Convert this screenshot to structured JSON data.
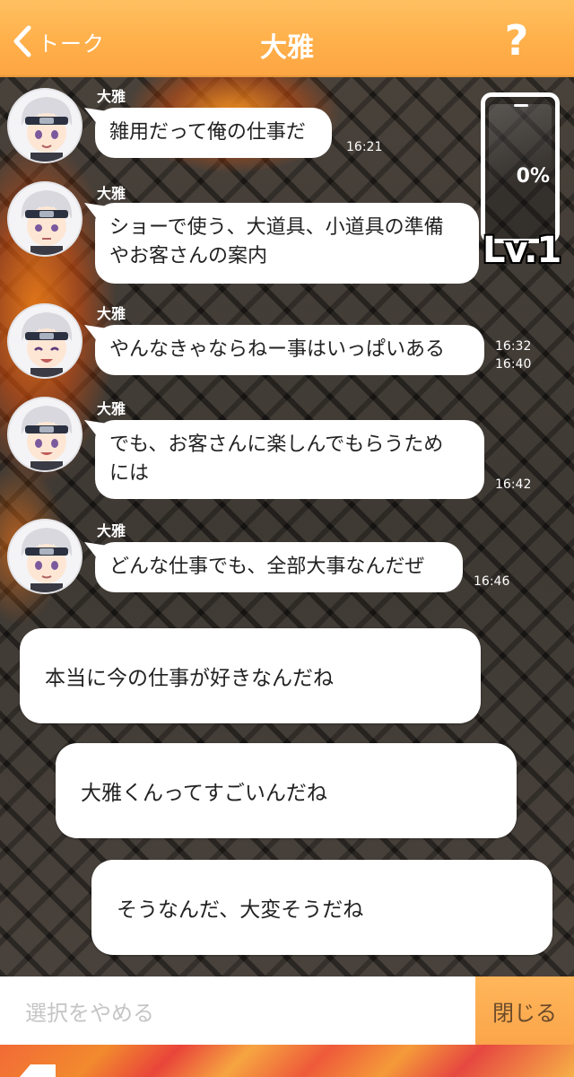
{
  "header": {
    "back_label": "トーク",
    "title": "大雅",
    "help_label": "?"
  },
  "meter": {
    "percent": "0%",
    "level": "Lv.1"
  },
  "messages": [
    {
      "sender": "大雅",
      "lines": [
        "雑用だって俺の仕事だ"
      ],
      "time": "16:21"
    },
    {
      "sender": "大雅",
      "lines": [
        "ショーで使う、大道具、小道具の準備",
        "やお客さんの案内"
      ],
      "time": "16:32"
    },
    {
      "sender": "大雅",
      "lines": [
        "やんなきゃならねー事はいっぱいある"
      ],
      "time": "16:40"
    },
    {
      "sender": "大雅",
      "lines": [
        "でも、お客さんに楽しんでもらうため",
        "には"
      ],
      "time": "16:42"
    },
    {
      "sender": "大雅",
      "lines": [
        "どんな仕事でも、全部大事なんだぜ"
      ],
      "time": "16:46"
    }
  ],
  "choices": [
    "本当に今の仕事が好きなんだね",
    "大雅くんってすごいんだね",
    "そうなんだ、大変そうだね"
  ],
  "bottom_bar": {
    "cancel_label": "選択をやめる",
    "close_label": "閉じる"
  },
  "colors": {
    "header": "#ffb04a",
    "bubble": "#ffffff",
    "close_button": "#fba54a"
  }
}
